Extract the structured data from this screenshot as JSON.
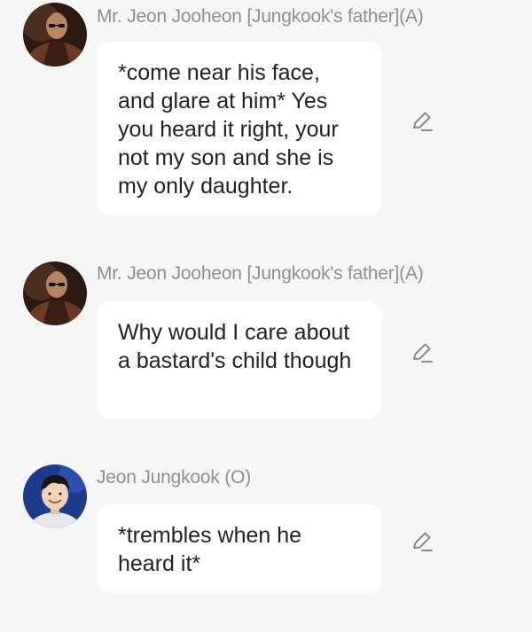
{
  "messages": [
    {
      "sender": "Mr. Jeon Jooheon [Jungkook's father](A)",
      "text": "*come near his face, and glare at him* Yes you heard it right, your not my son and she is my only daughter.",
      "avatar": "father-avatar",
      "action_icon": "pencil-icon"
    },
    {
      "sender": "Mr. Jeon Jooheon [Jungkook's father](A)",
      "text": "Why would I care about a bastard's child though",
      "avatar": "father-avatar",
      "action_icon": "pencil-icon"
    },
    {
      "sender": "Jeon Jungkook (O)",
      "text": "*trembles when he heard it*",
      "avatar": "jungkook-avatar",
      "action_icon": "pencil-icon"
    }
  ],
  "colors": {
    "background": "#f6f6f6",
    "bubble": "#ffffff",
    "sender_text": "#8e8e8e",
    "message_text": "#222222",
    "icon": "#8a8a8a"
  }
}
